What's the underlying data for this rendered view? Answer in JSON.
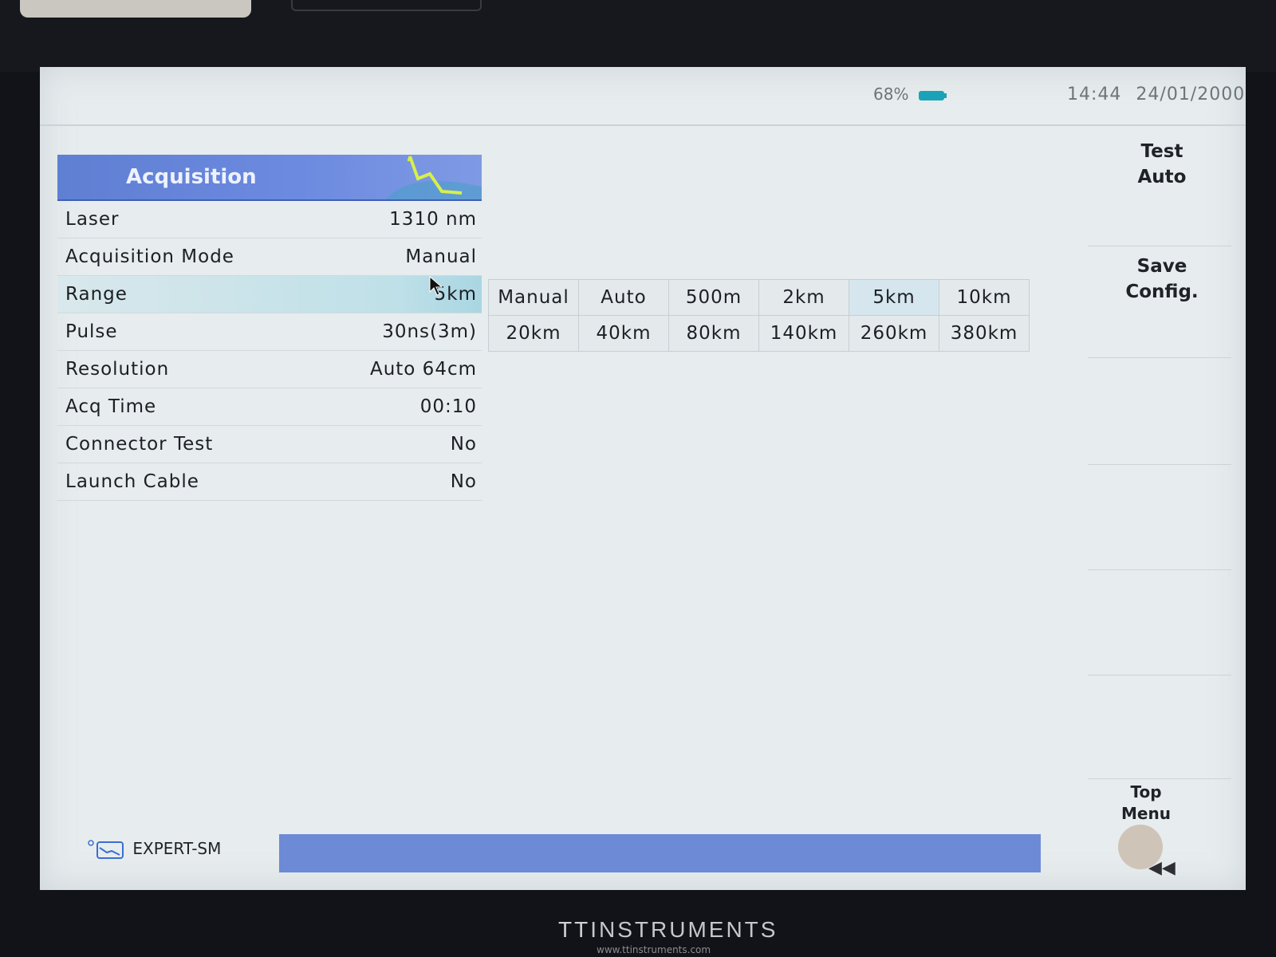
{
  "status": {
    "battery": "68%",
    "time": "14:44",
    "date": "24/01/2000"
  },
  "acquisition": {
    "title": "Acquisition",
    "rows": [
      {
        "label": "Laser",
        "value": "1310 nm"
      },
      {
        "label": "Acquisition Mode",
        "value": "Manual"
      },
      {
        "label": "Range",
        "value": "5km"
      },
      {
        "label": "Pulse",
        "value": "30ns(3m)"
      },
      {
        "label": "Resolution",
        "value": "Auto 64cm"
      },
      {
        "label": "Acq Time",
        "value": "00:10"
      },
      {
        "label": "Connector Test",
        "value": "No"
      },
      {
        "label": "Launch Cable",
        "value": "No"
      }
    ]
  },
  "range_options": [
    [
      "Manual",
      "Auto",
      "500m",
      "2km",
      "5km",
      "10km"
    ],
    [
      "20km",
      "40km",
      "80km",
      "140km",
      "260km",
      "380km"
    ]
  ],
  "softkeys": {
    "test_auto_line1": "Test",
    "test_auto_line2": "Auto",
    "save_config_line1": "Save",
    "save_config_line2": "Config.",
    "top_menu_line1": "Top",
    "top_menu_line2": "Menu"
  },
  "footer": {
    "mode": "EXPERT-SM"
  },
  "brand": {
    "name_tt": "TT",
    "name_rest": "INSTRUMENTS",
    "url": "www.ttinstruments.com"
  },
  "colors": {
    "header_blue": "#6d8be0",
    "status_bar_blue": "#6d8ad6",
    "screen_bg": "#e7ecee",
    "selected_row": "#bfe0e8"
  }
}
